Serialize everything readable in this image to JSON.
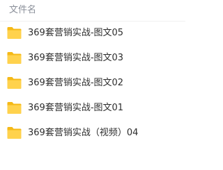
{
  "header": {
    "column_label": "文件名"
  },
  "files": [
    {
      "name": "369套营销实战-图文05",
      "icon": "folder-icon"
    },
    {
      "name": "369套营销实战-图文03",
      "icon": "folder-icon"
    },
    {
      "name": "369套营销实战-图文02",
      "icon": "folder-icon"
    },
    {
      "name": "369套营销实战-图文01",
      "icon": "folder-icon"
    },
    {
      "name": "369套营销实战（视频）04",
      "icon": "folder-icon"
    }
  ],
  "colors": {
    "folder_back": "#f5b917",
    "folder_front": "#ffd24d",
    "text": "#2d2d2d",
    "header_text": "#8a8f99"
  }
}
